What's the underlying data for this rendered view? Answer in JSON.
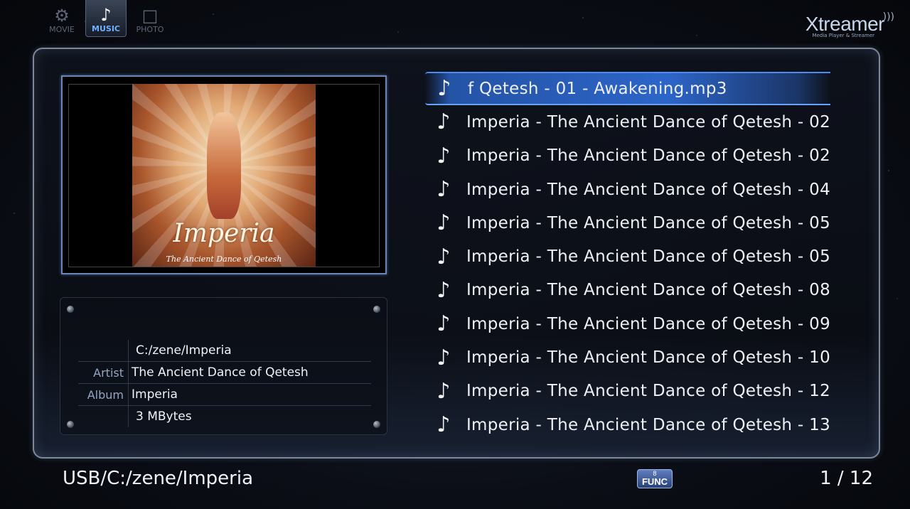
{
  "tabs": [
    {
      "label": "MOVIE",
      "icon": "movie-icon",
      "active": false
    },
    {
      "label": "MUSIC",
      "icon": "music-note-icon",
      "active": true
    },
    {
      "label": "PHOTO",
      "icon": "photo-icon",
      "active": false
    }
  ],
  "logo": {
    "name": "Xtreamer",
    "tagline": "Media Player & Streamer"
  },
  "album_art": {
    "title": "Imperia",
    "subtitle": "The Ancient Dance of Qetesh"
  },
  "info": {
    "path": "C:/zene/Imperia",
    "artist_label": "Artist",
    "artist": "The Ancient Dance of Qetesh",
    "album_label": "Album",
    "album": "Imperia",
    "size": "3 MBytes"
  },
  "tracks": [
    "f Qetesh - 01 - Awakening.mp3",
    "Imperia - The Ancient Dance of Qetesh - 02",
    "Imperia - The Ancient Dance of Qetesh - 02",
    "Imperia - The Ancient Dance of Qetesh - 04",
    "Imperia - The Ancient Dance of Qetesh - 05",
    "Imperia - The Ancient Dance of Qetesh - 05",
    "Imperia - The Ancient Dance of Qetesh - 08",
    "Imperia - The Ancient Dance of Qetesh - 09",
    "Imperia - The Ancient Dance of Qetesh - 10",
    "Imperia - The Ancient Dance of Qetesh - 12",
    "Imperia - The Ancient Dance of Qetesh - 13"
  ],
  "selected_track_index": 0,
  "footer": {
    "path": "USB/C:/zene/Imperia",
    "func_number": "8",
    "func_label": "FUNC",
    "page": "1 / 12"
  },
  "colors": {
    "accent": "#2f6fd8",
    "highlight_text": "#6fb0ff"
  }
}
